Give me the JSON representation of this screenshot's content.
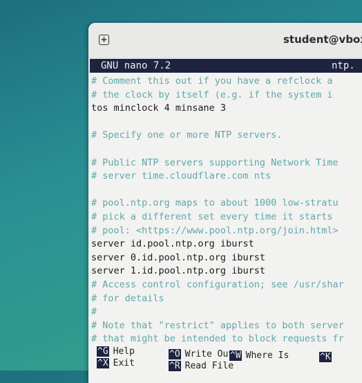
{
  "window": {
    "title": "student@vbox",
    "new_tab_icon": "plus-square-icon"
  },
  "nano": {
    "version": "GNU nano 7.2",
    "filename": "ntp."
  },
  "lines": [
    {
      "text": "# Comment this out if you have a refclock a",
      "type": "comment"
    },
    {
      "text": "# the clock by itself (e.g. if the system i",
      "type": "comment"
    },
    {
      "text": "tos minclock 4 minsane 3",
      "type": "code"
    },
    {
      "text": "",
      "type": "blank"
    },
    {
      "text": "# Specify one or more NTP servers.",
      "type": "comment"
    },
    {
      "text": "",
      "type": "blank"
    },
    {
      "text": "# Public NTP servers supporting Network Time",
      "type": "comment"
    },
    {
      "text": "# server time.cloudflare.com nts",
      "type": "comment"
    },
    {
      "text": "",
      "type": "blank"
    },
    {
      "text": "# pool.ntp.org maps to about 1000 low-stratu",
      "type": "comment"
    },
    {
      "text": "# pick a different set every time it starts",
      "type": "comment"
    },
    {
      "text": "# pool: <https://www.pool.ntp.org/join.html>",
      "type": "comment"
    },
    {
      "text": "server id.pool.ntp.org iburst",
      "type": "code"
    },
    {
      "text": "server 0.id.pool.ntp.org iburst",
      "type": "code"
    },
    {
      "text": "server 1.id.pool.ntp.org iburst",
      "type": "code"
    },
    {
      "text": "# Access control configuration; see /usr/shar",
      "type": "comment"
    },
    {
      "text": "# for details",
      "type": "comment"
    },
    {
      "text": "#",
      "type": "comment"
    },
    {
      "text": "# Note that \"restrict\" applies to both server",
      "type": "comment"
    },
    {
      "text": "# that might be intended to block requests fr",
      "type": "comment"
    }
  ],
  "shortcuts": [
    {
      "key": "^G",
      "label": "Help"
    },
    {
      "key": "^X",
      "label": "Exit"
    },
    {
      "key": "^O",
      "label": "Write Out"
    },
    {
      "key": "^R",
      "label": "Read File"
    },
    {
      "key": "^W",
      "label": "Where Is"
    },
    {
      "key": "^K",
      "label": ""
    }
  ]
}
